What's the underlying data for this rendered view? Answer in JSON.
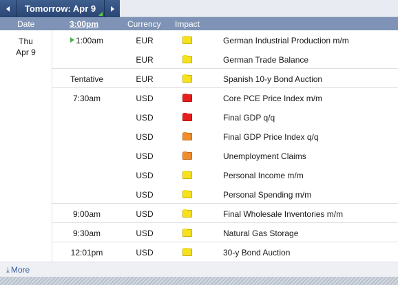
{
  "nav": {
    "title": "Tomorrow: Apr 9",
    "prev_icon": "chevron-left-icon",
    "next_icon": "chevron-right-icon"
  },
  "header": {
    "date": "Date",
    "time": "3:00pm",
    "currency": "Currency",
    "impact": "Impact"
  },
  "day": {
    "weekday": "Thu",
    "date": "Apr 9"
  },
  "colors": {
    "low": "#f5e11c",
    "medium": "#f08c2a",
    "high": "#e81e1e"
  },
  "events": [
    {
      "time": "1:00am",
      "currency": "EUR",
      "impact": "low",
      "title": "German Industrial Production m/m",
      "current": true
    },
    {
      "time": "",
      "currency": "EUR",
      "impact": "low",
      "title": "German Trade Balance"
    },
    {
      "time": "Tentative",
      "currency": "EUR",
      "impact": "low",
      "title": "Spanish 10-y Bond Auction"
    },
    {
      "time": "7:30am",
      "currency": "USD",
      "impact": "high",
      "title": "Core PCE Price Index m/m"
    },
    {
      "time": "",
      "currency": "USD",
      "impact": "high",
      "title": "Final GDP q/q"
    },
    {
      "time": "",
      "currency": "USD",
      "impact": "medium",
      "title": "Final GDP Price Index q/q"
    },
    {
      "time": "",
      "currency": "USD",
      "impact": "medium",
      "title": "Unemployment Claims"
    },
    {
      "time": "",
      "currency": "USD",
      "impact": "low",
      "title": "Personal Income m/m"
    },
    {
      "time": "",
      "currency": "USD",
      "impact": "low",
      "title": "Personal Spending m/m"
    },
    {
      "time": "9:00am",
      "currency": "USD",
      "impact": "low",
      "title": "Final Wholesale Inventories m/m"
    },
    {
      "time": "9:30am",
      "currency": "USD",
      "impact": "low",
      "title": "Natural Gas Storage"
    },
    {
      "time": "12:01pm",
      "currency": "USD",
      "impact": "low",
      "title": "30-y Bond Auction"
    }
  ],
  "footer": {
    "more_label": "More"
  }
}
